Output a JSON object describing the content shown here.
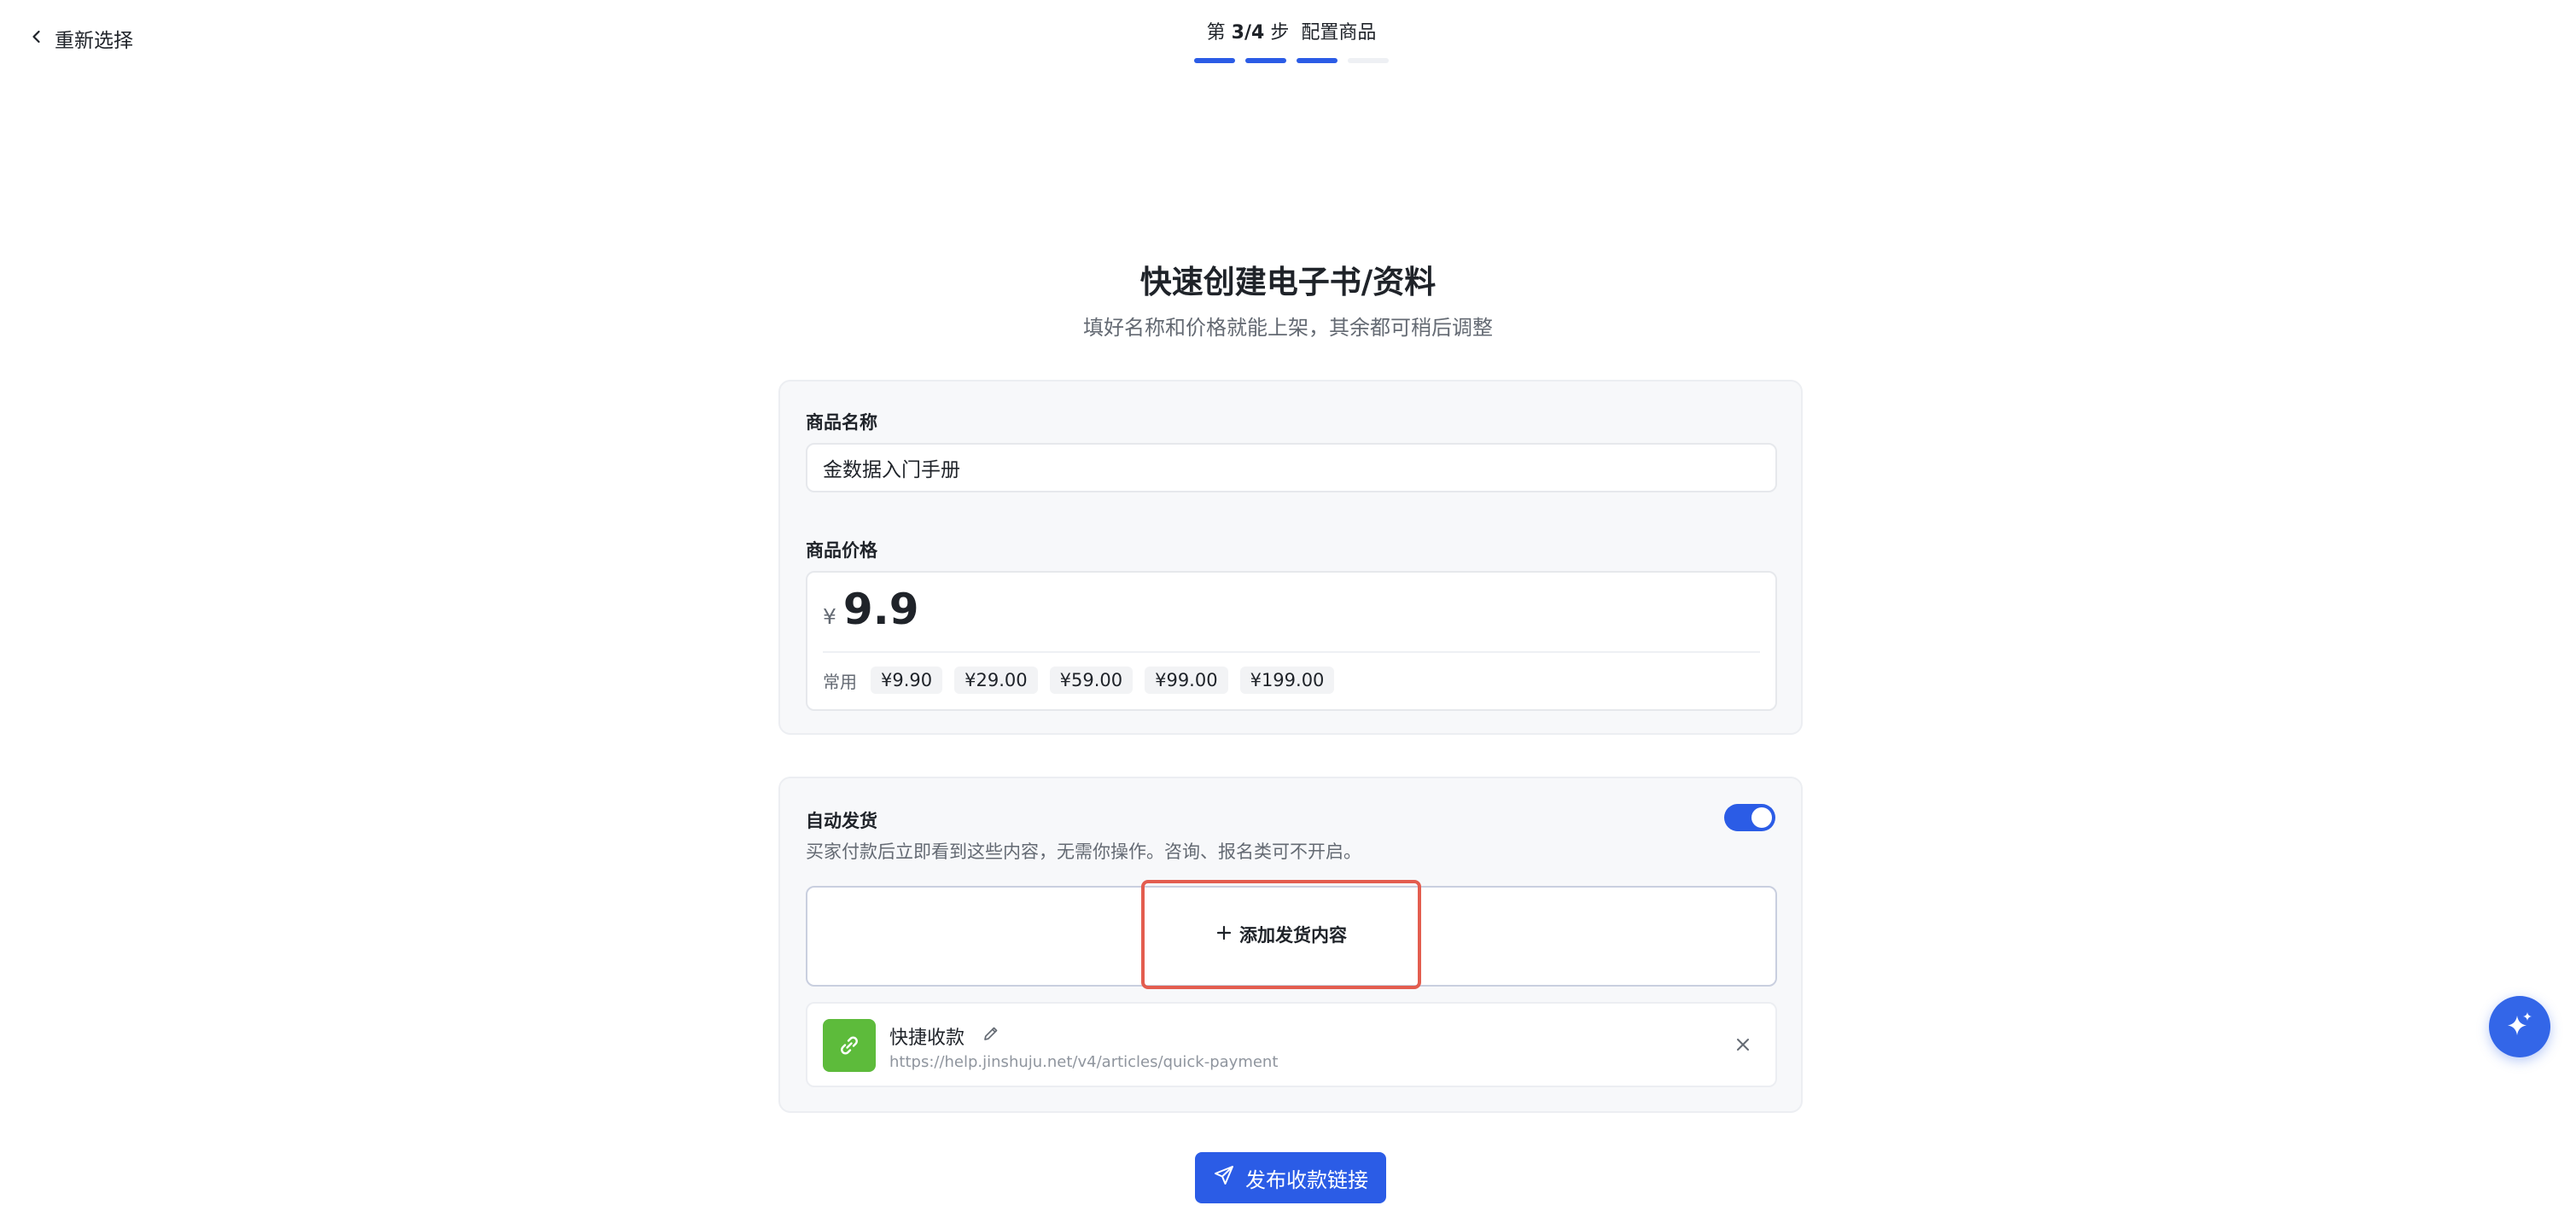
{
  "topbar": {
    "back_label": "重新选择",
    "step_prefix": "第",
    "step_current": "3/4",
    "step_suffix": "步",
    "step_name": "配置商品",
    "steps_total": 4,
    "steps_completed": 3
  },
  "header": {
    "title": "快速创建电子书/资料",
    "subtitle": "填好名称和价格就能上架，其余都可稍后调整"
  },
  "product": {
    "name_label": "商品名称",
    "name_value": "金数据入门手册",
    "price_label": "商品价格",
    "currency_symbol": "¥",
    "price_value": "9.9",
    "common_label": "常用",
    "common_prices": [
      "¥9.90",
      "¥29.00",
      "¥59.00",
      "¥99.00",
      "¥199.00"
    ]
  },
  "delivery": {
    "title": "自动发货",
    "description": "买家付款后立即看到这些内容，无需你操作。咨询、报名类可不开启。",
    "enabled": true,
    "add_label": "添加发货内容",
    "item": {
      "title": "快捷收款",
      "url": "https://help.jinshuju.net/v4/articles/quick-payment"
    }
  },
  "actions": {
    "publish_label": "发布收款链接"
  },
  "icons": {
    "back": "chevron-left-icon",
    "add": "plus-icon",
    "item": "link-icon",
    "edit": "pencil-icon",
    "remove": "close-icon",
    "publish": "send-icon",
    "assistant": "sparkle-icon"
  },
  "colors": {
    "primary": "#2b5ce6",
    "highlight": "#e35d4f",
    "item_icon_bg": "#5dbb3b"
  }
}
